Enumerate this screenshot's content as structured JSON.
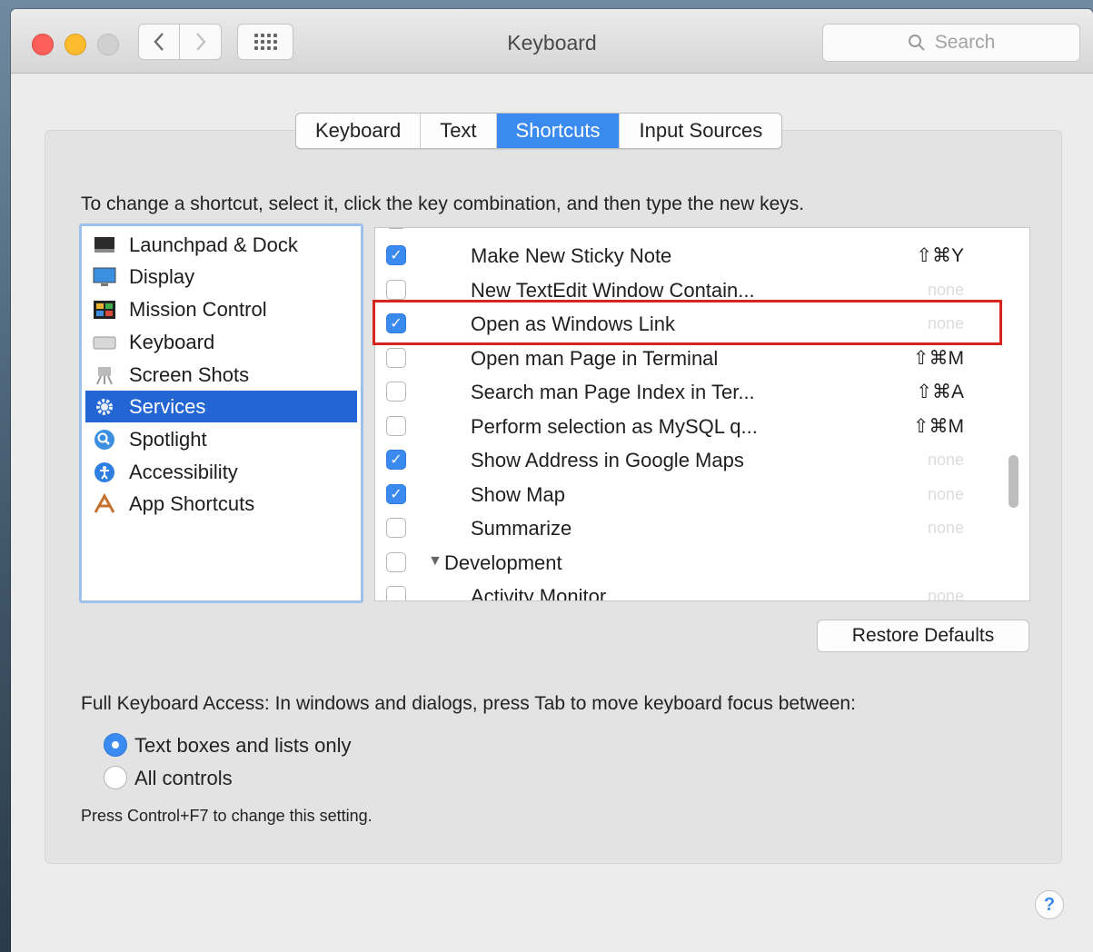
{
  "window": {
    "title": "Keyboard",
    "search_placeholder": "Search"
  },
  "tabs": [
    "Keyboard",
    "Text",
    "Shortcuts",
    "Input Sources"
  ],
  "active_tab": "Shortcuts",
  "hint": "To change a shortcut, select it, click the key combination, and then type the new keys.",
  "categories": [
    {
      "label": "Launchpad & Dock",
      "icon": "launchpad-dock-icon"
    },
    {
      "label": "Display",
      "icon": "display-icon"
    },
    {
      "label": "Mission Control",
      "icon": "mission-control-icon"
    },
    {
      "label": "Keyboard",
      "icon": "keyboard-icon"
    },
    {
      "label": "Screen Shots",
      "icon": "screen-shots-icon"
    },
    {
      "label": "Services",
      "icon": "gear-icon",
      "selected": true
    },
    {
      "label": "Spotlight",
      "icon": "spotlight-icon"
    },
    {
      "label": "Accessibility",
      "icon": "accessibility-icon"
    },
    {
      "label": "App Shortcuts",
      "icon": "app-shortcuts-icon"
    }
  ],
  "shortcuts": [
    {
      "label": "Make New Sticky Note",
      "checked": true,
      "key": "⇧⌘Y"
    },
    {
      "label": "New TextEdit Window Contain...",
      "checked": false,
      "key": "none"
    },
    {
      "label": "Open as Windows Link",
      "checked": true,
      "key": "none"
    },
    {
      "label": "Open man Page in Terminal",
      "checked": false,
      "key": "⇧⌘M"
    },
    {
      "label": "Search man Page Index in Ter...",
      "checked": false,
      "key": "⇧⌘A"
    },
    {
      "label": "Perform selection as MySQL q...",
      "checked": false,
      "key": "⇧⌘M"
    },
    {
      "label": "Show Address in Google Maps",
      "checked": true,
      "key": "none"
    },
    {
      "label": "Show Map",
      "checked": true,
      "key": "none"
    },
    {
      "label": "Summarize",
      "checked": false,
      "key": "none"
    },
    {
      "label": "Development",
      "checked": false,
      "key": ""
    },
    {
      "label": "Activity Monitor",
      "checked": false,
      "key": "none"
    }
  ],
  "restore_defaults": "Restore Defaults",
  "full_keyboard_access": "Full Keyboard Access: In windows and dialogs, press Tab to move keyboard focus between:",
  "radio_options": [
    {
      "label": "Text boxes and lists only",
      "selected": true
    },
    {
      "label": "All controls",
      "selected": false
    }
  ],
  "note": "Press Control+F7 to change this setting.",
  "help": "?",
  "colors": {
    "accent": "#3a8af0",
    "selection": "#2366d3",
    "highlight_border": "#d8261f"
  }
}
